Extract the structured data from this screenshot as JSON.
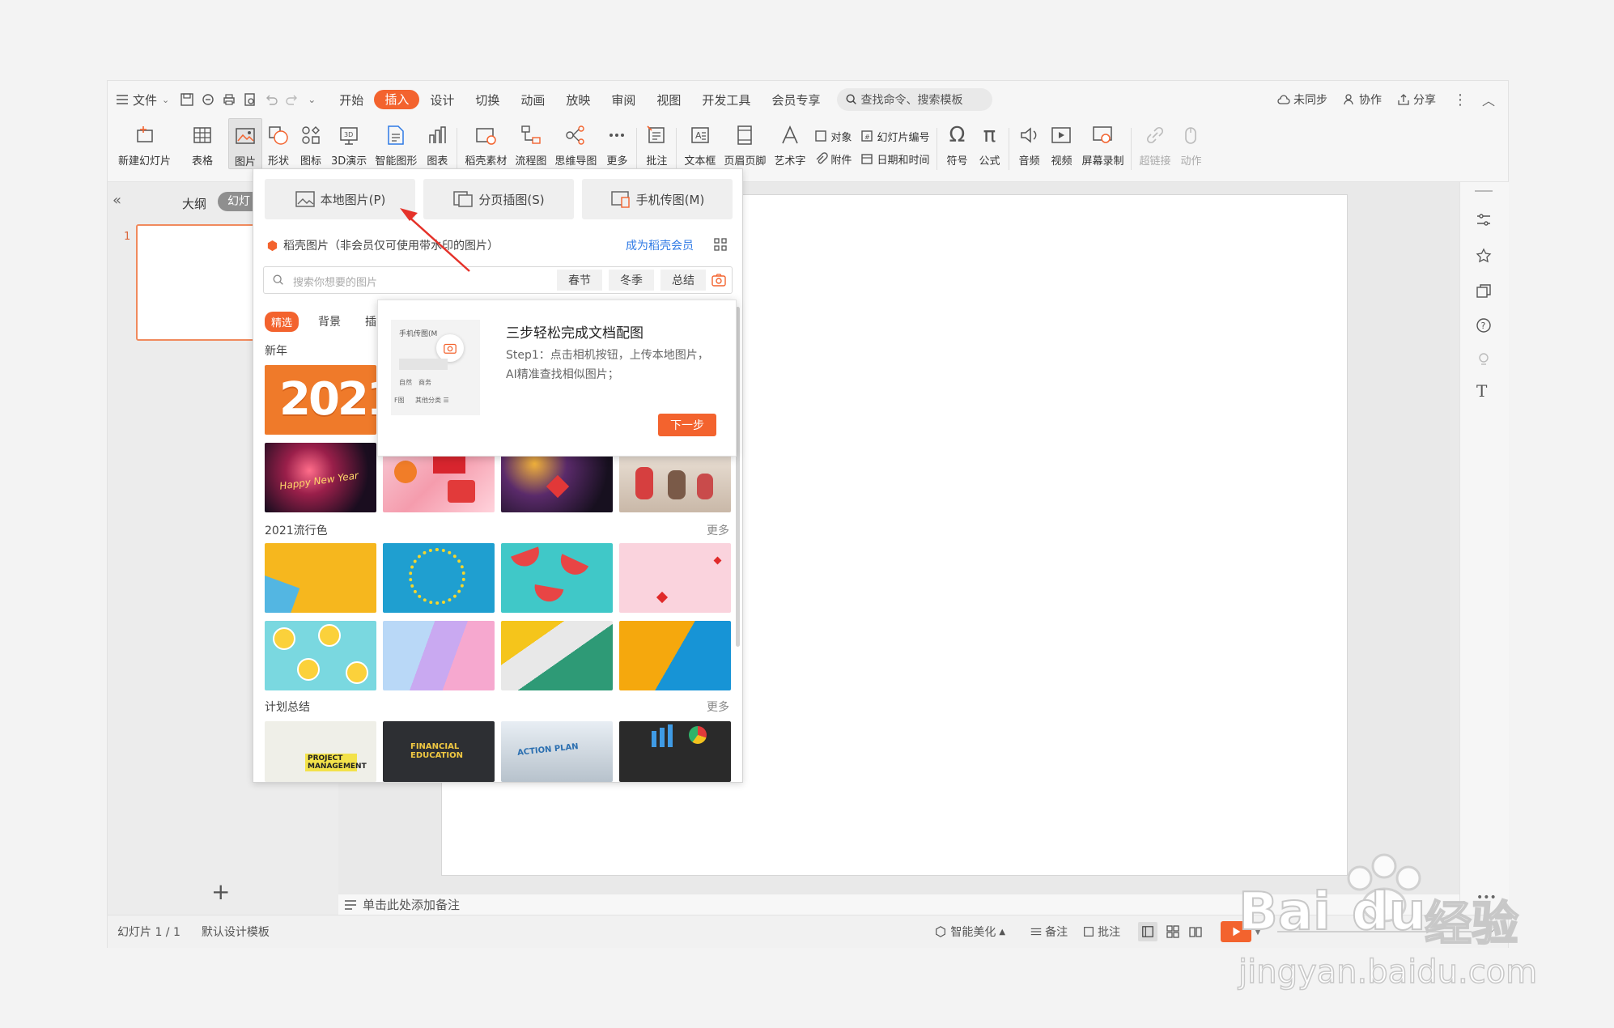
{
  "titlebar": {
    "menu_label": "文件",
    "tabs": [
      "开始",
      "插入",
      "设计",
      "切换",
      "动画",
      "放映",
      "审阅",
      "视图",
      "开发工具",
      "会员专享"
    ],
    "active_tab": "插入",
    "search_placeholder": "查找命令、搜索模板",
    "sync_label": "未同步",
    "collab_label": "协作",
    "share_label": "分享"
  },
  "ribbon": {
    "new_slide": "新建幻灯片",
    "table": "表格",
    "picture": "图片",
    "shape": "形状",
    "icon": "图标",
    "demo3d": "3D演示",
    "smartart": "智能图形",
    "chart": "图表",
    "material": "稻壳素材",
    "flowchart": "流程图",
    "mindmap": "思维导图",
    "more": "更多",
    "comment": "批注",
    "textbox": "文本框",
    "header_footer": "页眉页脚",
    "wordart": "艺术字",
    "object": "对象",
    "attachment": "附件",
    "slide_number": "幻灯片编号",
    "datetime": "日期和时间",
    "symbol": "符号",
    "formula": "公式",
    "audio": "音频",
    "video": "视频",
    "screen_record": "屏幕录制",
    "hyperlink": "超链接",
    "action": "动作"
  },
  "left_panel": {
    "outline_tab": "大纲",
    "slides_tab": "幻灯",
    "slide_index": "1"
  },
  "picture_popup": {
    "local_picture": "本地图片(P)",
    "paged_insert": "分页插图(S)",
    "phone_transfer": "手机传图(M)",
    "source_notice": "稻壳图片（非会员仅可使用带水印的图片）",
    "member_link": "成为稻壳会员",
    "search_placeholder": "搜索你想要的图片",
    "tags": [
      "春节",
      "冬季",
      "总结"
    ],
    "categories": [
      "精选",
      "背景",
      "插"
    ],
    "section_newyear": "新年",
    "section_colors": "2021流行色",
    "section_plan": "计划总结",
    "more_label": "更多",
    "year_text": "2021",
    "fireworks_text": "Happy New Year",
    "plan_texts": [
      "PROJECT MANAGEMENT",
      "FINANCIAL EDUCATION",
      "ACTION PLAN"
    ]
  },
  "tip_popup": {
    "title": "三步轻松完成文档配图",
    "step_text": "Step1：点击相机按钮，上传本地图片，AI精准查找相似图片；",
    "next_button": "下一步",
    "mini_label": "手机传图(M",
    "mini_tags": [
      "自然",
      "商务",
      "其他分类 ☰"
    ],
    "mini_side": "F图"
  },
  "editor": {
    "notes_placeholder": "单击此处添加备注"
  },
  "statusbar": {
    "slide_count": "幻灯片 1 / 1",
    "template": "默认设计模板",
    "smart_beautify": "智能美化",
    "notes": "备注",
    "comment": "批注"
  },
  "watermark": {
    "brand": "Bai",
    "brand2": "du",
    "jingyan": "经验",
    "url": "jingyan.baidu.com"
  },
  "colors": {
    "accent": "#f3632e",
    "link": "#2f7ae5"
  }
}
